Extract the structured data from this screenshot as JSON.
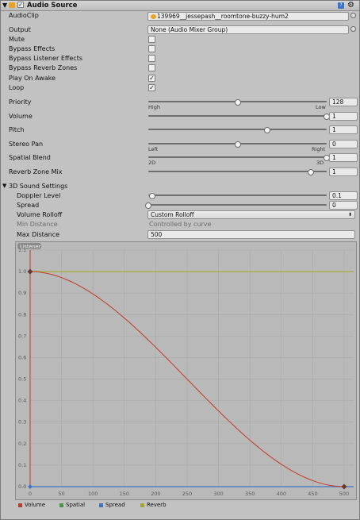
{
  "header": {
    "title": "Audio Source",
    "enabled": true
  },
  "audio_clip": {
    "label": "AudioClip",
    "value": "139969__jessepash__roomtone-buzzy-hum2"
  },
  "output": {
    "label": "Output",
    "value": "None (Audio Mixer Group)"
  },
  "toggles": [
    {
      "label": "Mute",
      "checked": false
    },
    {
      "label": "Bypass Effects",
      "checked": false
    },
    {
      "label": "Bypass Listener Effects",
      "checked": false
    },
    {
      "label": "Bypass Reverb Zones",
      "checked": false
    },
    {
      "label": "Play On Awake",
      "checked": true
    },
    {
      "label": "Loop",
      "checked": true
    }
  ],
  "sliders": {
    "priority": {
      "label": "Priority",
      "value": "128",
      "fraction": 0.5,
      "min_label": "High",
      "max_label": "Low"
    },
    "volume": {
      "label": "Volume",
      "value": "1",
      "fraction": 1.0
    },
    "pitch": {
      "label": "Pitch",
      "value": "1",
      "fraction": 0.667
    },
    "stereo_pan": {
      "label": "Stereo Pan",
      "value": "0",
      "fraction": 0.5,
      "min_label": "Left",
      "max_label": "Right"
    },
    "spatial_blend": {
      "label": "Spatial Blend",
      "value": "1",
      "fraction": 1.0,
      "min_label": "2D",
      "max_label": "3D"
    },
    "reverb_zone_mix": {
      "label": "Reverb Zone Mix",
      "value": "1",
      "fraction": 0.909
    }
  },
  "sound3d": {
    "section_label": "3D Sound Settings",
    "doppler": {
      "label": "Doppler Level",
      "value": "0.1",
      "fraction": 0.02
    },
    "spread": {
      "label": "Spread",
      "value": "0",
      "fraction": 0.0
    },
    "volume_rolloff": {
      "label": "Volume Rolloff",
      "value": "Custom Rolloff"
    },
    "min_distance": {
      "label": "Min Distance",
      "value": "Controlled by curve"
    },
    "max_distance": {
      "label": "Max Distance",
      "value": "500"
    }
  },
  "graph": {
    "listener_tag": "Listener",
    "y_ticks": [
      "1.1",
      "1.0",
      "0.9",
      "0.8",
      "0.7",
      "0.6",
      "0.5",
      "0.4",
      "0.3",
      "0.2",
      "0.1",
      "0.0"
    ],
    "x_ticks": [
      "0",
      "50",
      "100",
      "150",
      "200",
      "250",
      "300",
      "350",
      "400",
      "450",
      "500"
    ],
    "curves": {
      "volume": {
        "color": "#c0392b",
        "shape": "smooth falloff from 1.0 at 0 to 0.0 at 500"
      },
      "reverb": {
        "color": "#a4a820",
        "value": 1.0
      },
      "spread": {
        "color": "#3d74c6",
        "value": 0.0
      }
    },
    "legend": [
      {
        "label": "Volume",
        "color": "#c0392b"
      },
      {
        "label": "Spatial",
        "color": "#3f9b3f"
      },
      {
        "label": "Spread",
        "color": "#3d74c6"
      },
      {
        "label": "Reverb",
        "color": "#a4a820"
      }
    ]
  }
}
